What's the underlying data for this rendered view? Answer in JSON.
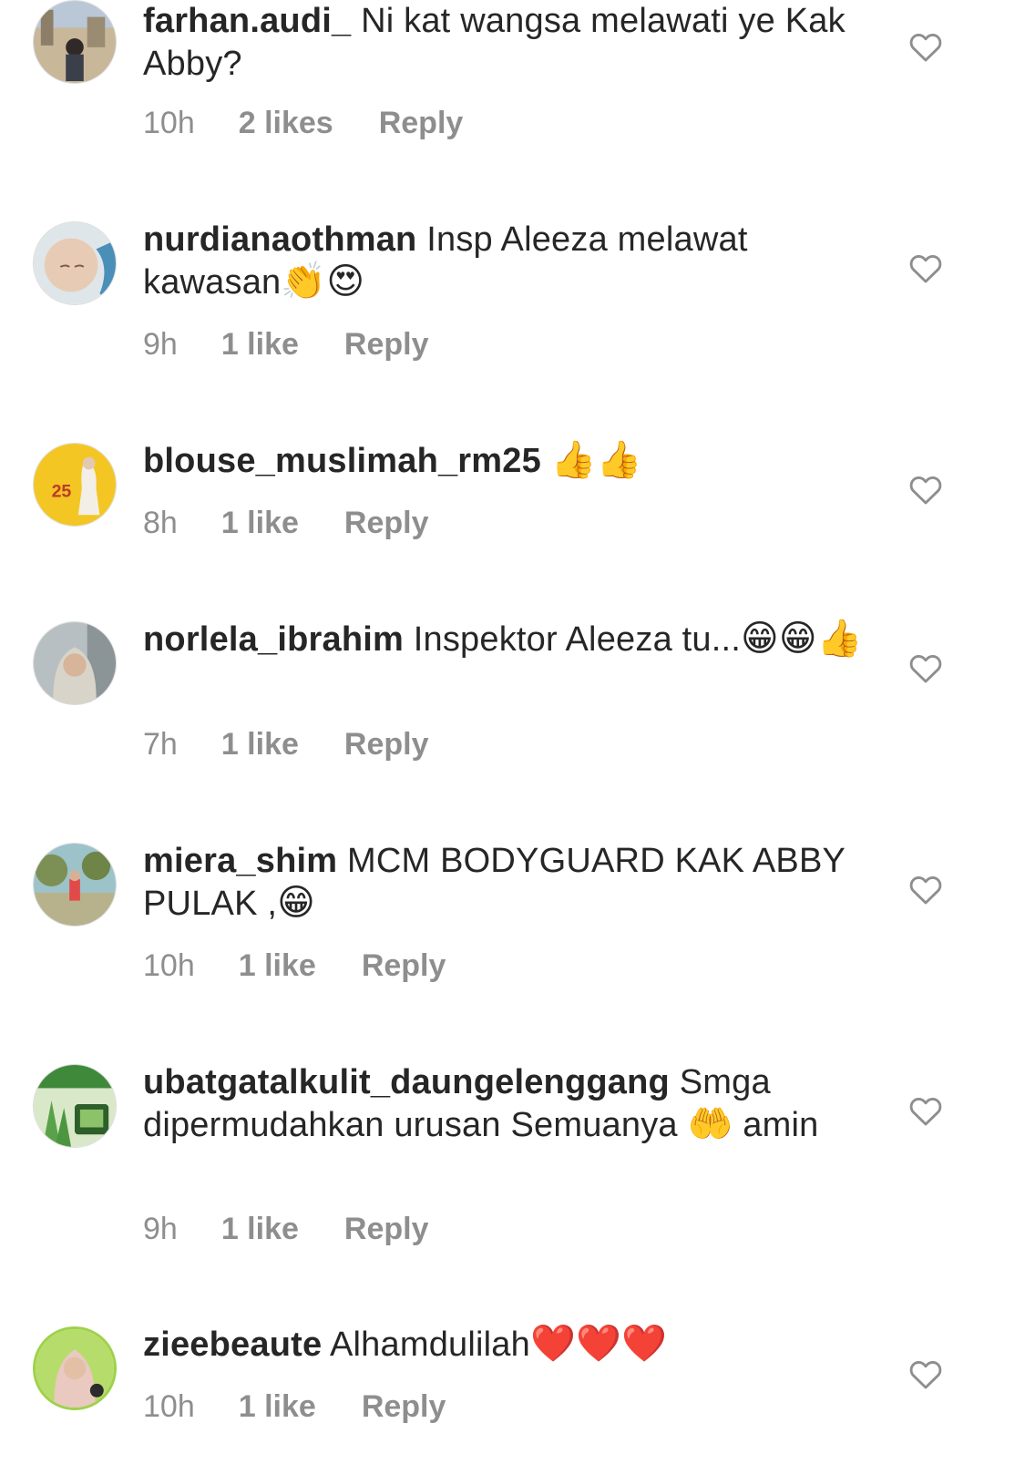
{
  "comments": [
    {
      "username": "farhan.audi_",
      "text": "Ni kat wangsa melawati ye Kak Abby?",
      "emoji": "",
      "time": "10h",
      "likes": "2 likes",
      "reply": "Reply",
      "avatar_colors": [
        "#c9b79a",
        "#7a8ca3"
      ]
    },
    {
      "username": "nurdianaothman",
      "text": "Insp Aleeza melawat kawasan",
      "emoji": "👏😍",
      "time": "9h",
      "likes": "1 like",
      "reply": "Reply",
      "avatar_colors": [
        "#e8cbb5",
        "#4a8fb8"
      ]
    },
    {
      "username": "blouse_muslimah_rm25",
      "text": "",
      "emoji": "👍👍",
      "time": "8h",
      "likes": "1 like",
      "reply": "Reply",
      "avatar_colors": [
        "#f3c623",
        "#ffffff"
      ],
      "avatar_text": "25"
    },
    {
      "username": "norlela_ibrahim",
      "text": "Inspektor Aleeza tu...",
      "emoji": "😁😁👍",
      "time": "7h",
      "likes": "1 like",
      "reply": "Reply",
      "avatar_colors": [
        "#9aa7a8",
        "#d9d4ca"
      ]
    },
    {
      "username": "miera_shim",
      "text": "MCM BODYGUARD KAK ABBY PULAK ,",
      "emoji": "😁",
      "time": "10h",
      "likes": "1 like",
      "reply": "Reply",
      "avatar_colors": [
        "#9cc3c9",
        "#7c8f54"
      ]
    },
    {
      "username": "ubatgatalkulit_daungelenggang",
      "text": "Smga dipermudahkan urusan Semuanya",
      "emoji": "🤲",
      "text_after": "amin",
      "time": "9h",
      "likes": "1 like",
      "reply": "Reply",
      "avatar_colors": [
        "#3f8a3a",
        "#d8e8c8"
      ]
    },
    {
      "username": "zieebeaute",
      "text": "Alhamdulilah",
      "emoji": "❤️❤️❤️",
      "time": "10h",
      "likes": "1 like",
      "reply": "Reply",
      "avatar_colors": [
        "#9fd14a",
        "#e9c9c0"
      ]
    }
  ],
  "colors": {
    "text": "#262626",
    "meta": "#8e8e8e",
    "heart_outline": "#8e8e8e"
  }
}
